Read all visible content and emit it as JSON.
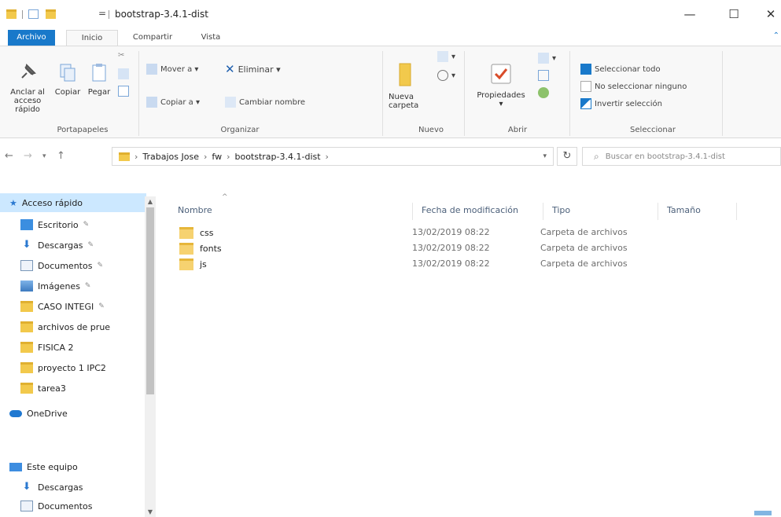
{
  "window": {
    "title": "bootstrap-3.4.1-dist",
    "qa_separator": "=",
    "minimize": "—",
    "maximize": "☐",
    "close": "✕"
  },
  "ribbon_tabs": [
    "Archivo",
    "Inicio",
    "Compartir",
    "Vista"
  ],
  "ribbon": {
    "portapapeles": {
      "label": "Portapapeles",
      "pin_label": "Anclar al acceso rápido",
      "copy_label": "Copiar",
      "paste_label": "Pegar"
    },
    "organizar": {
      "label": "Organizar",
      "move_to": "Mover a ▾",
      "copy_to": "Copiar a ▾",
      "delete": "Eliminar ▾",
      "rename": "Cambiar nombre"
    },
    "nuevo": {
      "label": "Nuevo",
      "new_folder": "Nueva carpeta"
    },
    "abrir": {
      "label": "Abrir",
      "properties": "Propiedades"
    },
    "seleccionar": {
      "label": "Seleccionar",
      "select_all": "Seleccionar todo",
      "select_none": "No seleccionar ninguno",
      "invert": "Invertir selección"
    }
  },
  "address": {
    "crumbs": [
      "Trabajos Jose",
      "fw",
      "bootstrap-3.4.1-dist"
    ],
    "search_placeholder": "Buscar en bootstrap-3.4.1-dist"
  },
  "nav_pane": {
    "quick_access": "Acceso rápido",
    "items": [
      {
        "label": "Escritorio",
        "pinned": true
      },
      {
        "label": "Descargas",
        "pinned": true
      },
      {
        "label": "Documentos",
        "pinned": true
      },
      {
        "label": "Imágenes",
        "pinned": true
      },
      {
        "label": "CASO INTEGI",
        "pinned": true
      },
      {
        "label": "archivos de prue",
        "pinned": false
      },
      {
        "label": "FISICA 2",
        "pinned": false
      },
      {
        "label": "proyecto 1 IPC2",
        "pinned": false
      },
      {
        "label": "tarea3",
        "pinned": false
      }
    ],
    "onedrive": "OneDrive",
    "this_pc": "Este equipo",
    "this_pc_items": [
      "Descargas",
      "Documentos"
    ]
  },
  "file_list": {
    "columns": [
      "Nombre",
      "Fecha de modificación",
      "Tipo",
      "Tamaño"
    ],
    "rows": [
      {
        "name": "css",
        "date": "13/02/2019 08:22",
        "type": "Carpeta de archivos",
        "size": ""
      },
      {
        "name": "fonts",
        "date": "13/02/2019 08:22",
        "type": "Carpeta de archivos",
        "size": ""
      },
      {
        "name": "js",
        "date": "13/02/2019 08:22",
        "type": "Carpeta de archivos",
        "size": ""
      }
    ]
  },
  "colors": {
    "accent": "#1979ca",
    "selection": "#cce8ff",
    "folder": "#f2c94c"
  }
}
